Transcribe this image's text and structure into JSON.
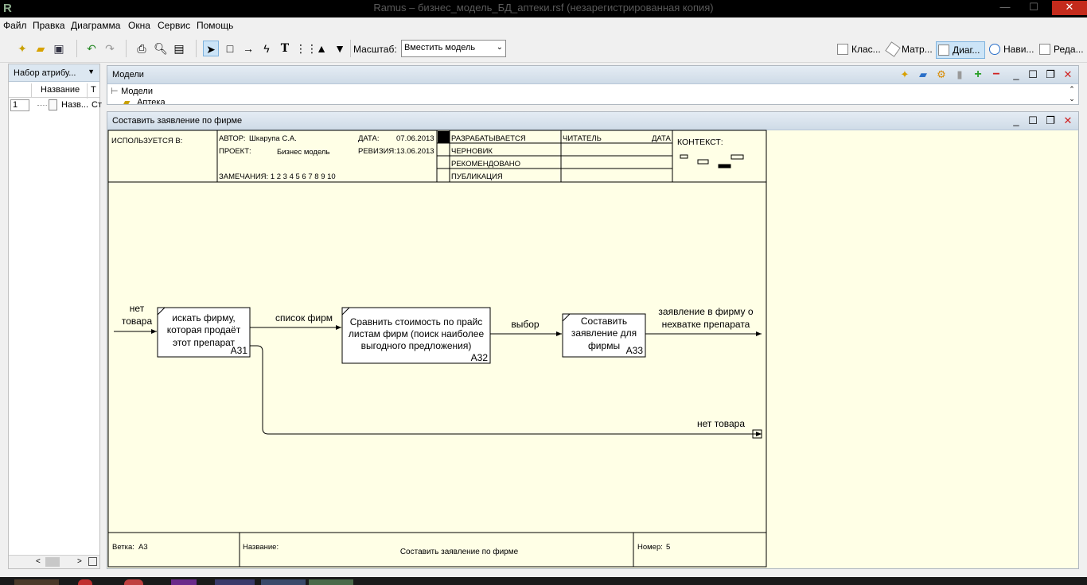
{
  "window": {
    "title": "Ramus – бизнес_модель_БД_аптеки.rsf (незарегистрированная копия)",
    "minimize": "—",
    "maximize": "☐",
    "close": "✕"
  },
  "menu": [
    "Файл",
    "Правка",
    "Диаграмма",
    "Окна",
    "Сервис",
    "Помощь"
  ],
  "toolbar": {
    "zoom_label": "Масштаб:",
    "zoom_value": "Вместить модель",
    "right_buttons": [
      "Клас...",
      "Матр...",
      "Диаг...",
      "Нави...",
      "Реда..."
    ]
  },
  "attributes_panel": {
    "title": "Набор атрибу...",
    "col_name": "Название",
    "col_type": "Т",
    "row_num": "1",
    "row_name": "Назв...",
    "row_type": "Ст"
  },
  "models_panel": {
    "title": "Модели",
    "tree_root": "Модели",
    "tree_child": "Аптека"
  },
  "diagram_window": {
    "title": "Составить заявление по фирме"
  },
  "frame": {
    "used_in": "ИСПОЛЬЗУЕТСЯ В:",
    "author_label": "АВТОР:",
    "author": "Шкарупа С.А.",
    "project_label": "ПРОЕКТ:",
    "project": "Бизнес модель",
    "notes": "ЗАМЕЧАНИЯ:  1  2  3  4  5  6  7  8  9  10",
    "date_label": "ДАТА:",
    "date": "07.06.2013",
    "revision_label": "РЕВИЗИЯ:",
    "revision": "13.06.2013",
    "status": [
      "РАЗРАБАТЫВАЕТСЯ",
      "ЧЕРНОВИК",
      "РЕКОМЕНДОВАНО",
      "ПУБЛИКАЦИЯ"
    ],
    "reader": "ЧИТАТЕЛЬ",
    "reader_date": "ДАТА",
    "context": "КОНТЕКСТ:",
    "branch_label": "Ветка:",
    "branch": "А3",
    "name_label": "Название:",
    "name": "Составить заявление по фирме",
    "number_label": "Номер:",
    "number": "5"
  },
  "diagram": {
    "boxes": [
      {
        "lines": [
          "искать фирму,",
          "которая продаёт",
          "этот препарат"
        ],
        "id": "А31"
      },
      {
        "lines": [
          "Сравнить стоимость по прайс",
          "листам фирм (поиск наиболее",
          "выгодного предложения)"
        ],
        "id": "А32"
      },
      {
        "lines": [
          "Составить",
          "заявление для",
          "фирмы"
        ],
        "id": "А33"
      }
    ],
    "arrows": {
      "input": [
        "нет",
        "товара"
      ],
      "a31_a32": "список фирм",
      "a32_a33": "выбор",
      "output": [
        "заявление в фирму о",
        "нехватке препарата"
      ],
      "bottom": "нет товара"
    }
  },
  "colors": {
    "canvas": "#ffffe6",
    "panel_header": "#d9e4ef",
    "selected": "#cce4f7"
  }
}
